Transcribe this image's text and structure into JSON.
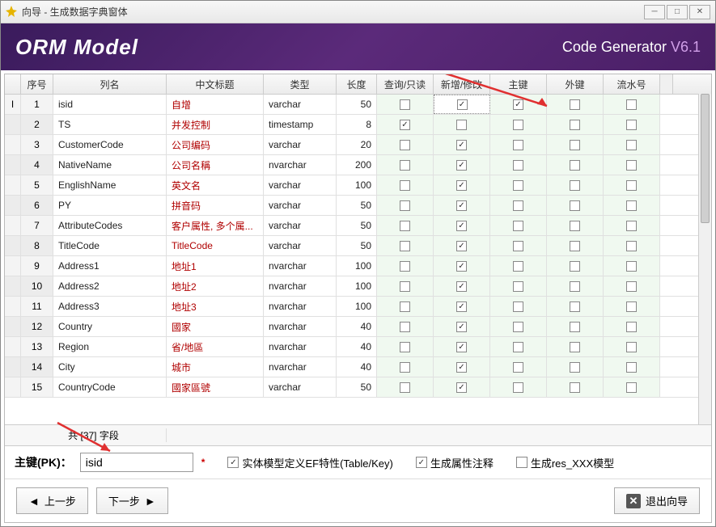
{
  "window": {
    "title": "向导 - 生成数据字典窗体"
  },
  "banner": {
    "title": "ORM Model",
    "product": "Code Generator",
    "version": "V6.1"
  },
  "columns": {
    "seq": "序号",
    "name": "列名",
    "cn": "中文标题",
    "type": "类型",
    "len": "长度",
    "qro": "查询/只读",
    "edit": "新增/修改",
    "pk": "主键",
    "fk": "外键",
    "serial": "流水号"
  },
  "rows": [
    {
      "seq": 1,
      "marker": "I",
      "name": "isid",
      "cn": "自增",
      "type": "varchar",
      "len": 50,
      "qro": false,
      "edit": true,
      "pk": true,
      "fk": false,
      "serial": false,
      "selected": true
    },
    {
      "seq": 2,
      "name": "TS",
      "cn": "并发控制",
      "type": "timestamp",
      "len": 8,
      "qro": true,
      "edit": false,
      "pk": false,
      "fk": false,
      "serial": false
    },
    {
      "seq": 3,
      "name": "CustomerCode",
      "cn": "公司编码",
      "type": "varchar",
      "len": 20,
      "qro": false,
      "edit": true,
      "pk": false,
      "fk": false,
      "serial": false
    },
    {
      "seq": 4,
      "name": "NativeName",
      "cn": "公司名稱",
      "type": "nvarchar",
      "len": 200,
      "qro": false,
      "edit": true,
      "pk": false,
      "fk": false,
      "serial": false
    },
    {
      "seq": 5,
      "name": "EnglishName",
      "cn": "英文名",
      "type": "varchar",
      "len": 100,
      "qro": false,
      "edit": true,
      "pk": false,
      "fk": false,
      "serial": false
    },
    {
      "seq": 6,
      "name": "PY",
      "cn": "拼音码",
      "type": "varchar",
      "len": 50,
      "qro": false,
      "edit": true,
      "pk": false,
      "fk": false,
      "serial": false
    },
    {
      "seq": 7,
      "name": "AttributeCodes",
      "cn": "客户属性, 多个属...",
      "type": "varchar",
      "len": 50,
      "qro": false,
      "edit": true,
      "pk": false,
      "fk": false,
      "serial": false
    },
    {
      "seq": 8,
      "name": "TitleCode",
      "cn": "TitleCode",
      "type": "varchar",
      "len": 50,
      "qro": false,
      "edit": true,
      "pk": false,
      "fk": false,
      "serial": false
    },
    {
      "seq": 9,
      "name": "Address1",
      "cn": "地址1",
      "type": "nvarchar",
      "len": 100,
      "qro": false,
      "edit": true,
      "pk": false,
      "fk": false,
      "serial": false
    },
    {
      "seq": 10,
      "name": "Address2",
      "cn": "地址2",
      "type": "nvarchar",
      "len": 100,
      "qro": false,
      "edit": true,
      "pk": false,
      "fk": false,
      "serial": false
    },
    {
      "seq": 11,
      "name": "Address3",
      "cn": "地址3",
      "type": "nvarchar",
      "len": 100,
      "qro": false,
      "edit": true,
      "pk": false,
      "fk": false,
      "serial": false
    },
    {
      "seq": 12,
      "name": "Country",
      "cn": "國家",
      "type": "nvarchar",
      "len": 40,
      "qro": false,
      "edit": true,
      "pk": false,
      "fk": false,
      "serial": false
    },
    {
      "seq": 13,
      "name": "Region",
      "cn": "省/地區",
      "type": "nvarchar",
      "len": 40,
      "qro": false,
      "edit": true,
      "pk": false,
      "fk": false,
      "serial": false
    },
    {
      "seq": 14,
      "name": "City",
      "cn": "城市",
      "type": "nvarchar",
      "len": 40,
      "qro": false,
      "edit": true,
      "pk": false,
      "fk": false,
      "serial": false
    },
    {
      "seq": 15,
      "name": "CountryCode",
      "cn": "國家區號",
      "type": "varchar",
      "len": 50,
      "qro": false,
      "edit": true,
      "pk": false,
      "fk": false,
      "serial": false
    }
  ],
  "footer": {
    "count_label": "共 [37] 字段"
  },
  "pk": {
    "label": "主键(PK)：",
    "value": "isid"
  },
  "options": {
    "ef": {
      "label": "实体模型定义EF特性(Table/Key)",
      "checked": true
    },
    "comment": {
      "label": "生成属性注释",
      "checked": true
    },
    "resxxx": {
      "label": "生成res_XXX模型",
      "checked": false
    }
  },
  "nav": {
    "prev": "上一步",
    "next": "下一步",
    "exit": "退出向导"
  }
}
